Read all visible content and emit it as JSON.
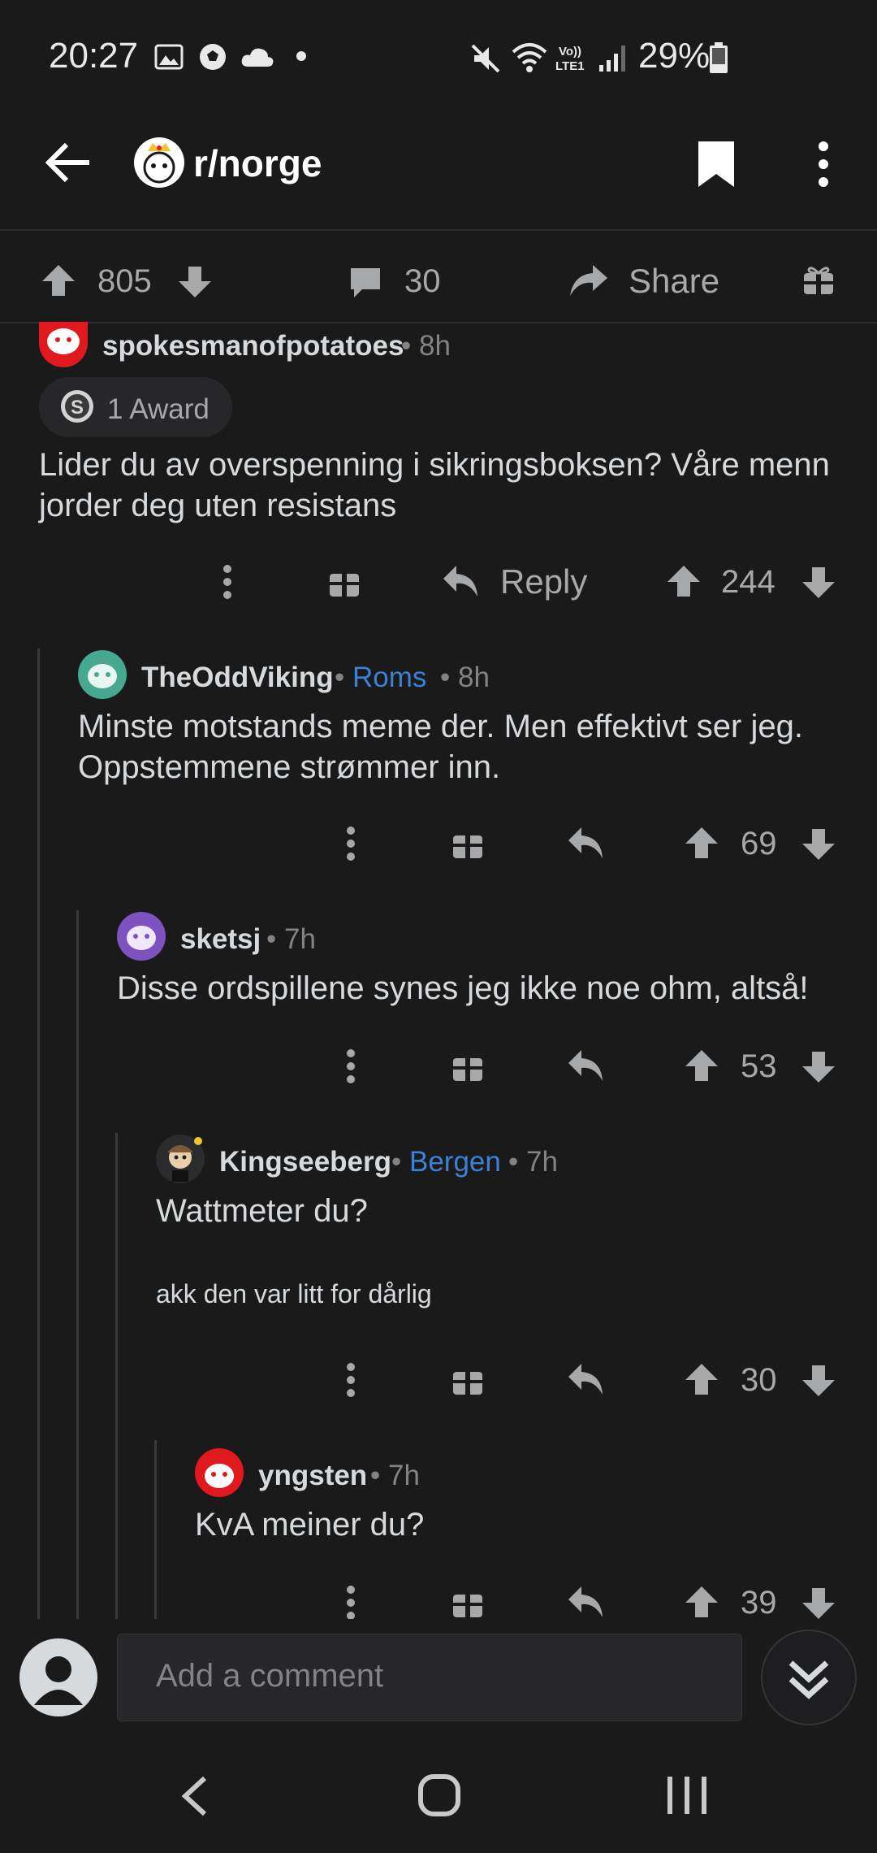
{
  "status_bar": {
    "time": "20:27",
    "battery": "29%"
  },
  "header": {
    "title": "r/norge"
  },
  "post_actions": {
    "upvotes": "805",
    "comments": "30",
    "share": "Share"
  },
  "comments": [
    {
      "user": "spokesmanofpotatoes",
      "time": "• 8h",
      "award": "1 Award",
      "body_line1": "Lider du av overspenning i sikringsboksen? Våre menn",
      "body_line2": "jorder deg uten resistans",
      "reply": "Reply",
      "score": "244"
    },
    {
      "user": "TheOddViking",
      "flair": "Roms",
      "time": "• 8h",
      "body_line1": "Minste motstands meme der. Men effektivt ser jeg.",
      "body_line2": "Oppstemmene strømmer inn.",
      "score": "69"
    },
    {
      "user": "sketsj",
      "time": "• 7h",
      "body_line1": "Disse ordspillene synes jeg ikke noe ohm, altså!",
      "score": "53"
    },
    {
      "user": "Kingseeberg",
      "flair": "Bergen",
      "time": "• 7h",
      "body_line1": "Wattmeter du?",
      "small": "akk den var litt for dårlig",
      "score": "30"
    },
    {
      "user": "yngsten",
      "time": "• 7h",
      "body_line1": "KvA meiner du?",
      "score": "39"
    }
  ],
  "composer": {
    "placeholder": "Add a comment"
  },
  "icons": {
    "back": "back-arrow-icon",
    "avatar": "subreddit-avatar-icon",
    "bookmark": "bookmark-icon",
    "more": "more-vertical-icon",
    "upvote": "upvote-arrow-icon",
    "downvote": "downvote-arrow-icon",
    "comment": "comment-bubble-icon",
    "share": "share-arrow-icon",
    "award": "gift-award-icon",
    "reply": "reply-arrow-icon",
    "collapse": "collapse-chevrons-icon"
  },
  "colors": {
    "background": "#1a1a1b",
    "text": "#d7dadc",
    "muted": "#818384",
    "flair": "#3b82d6",
    "accent_red": "#e0191f"
  }
}
